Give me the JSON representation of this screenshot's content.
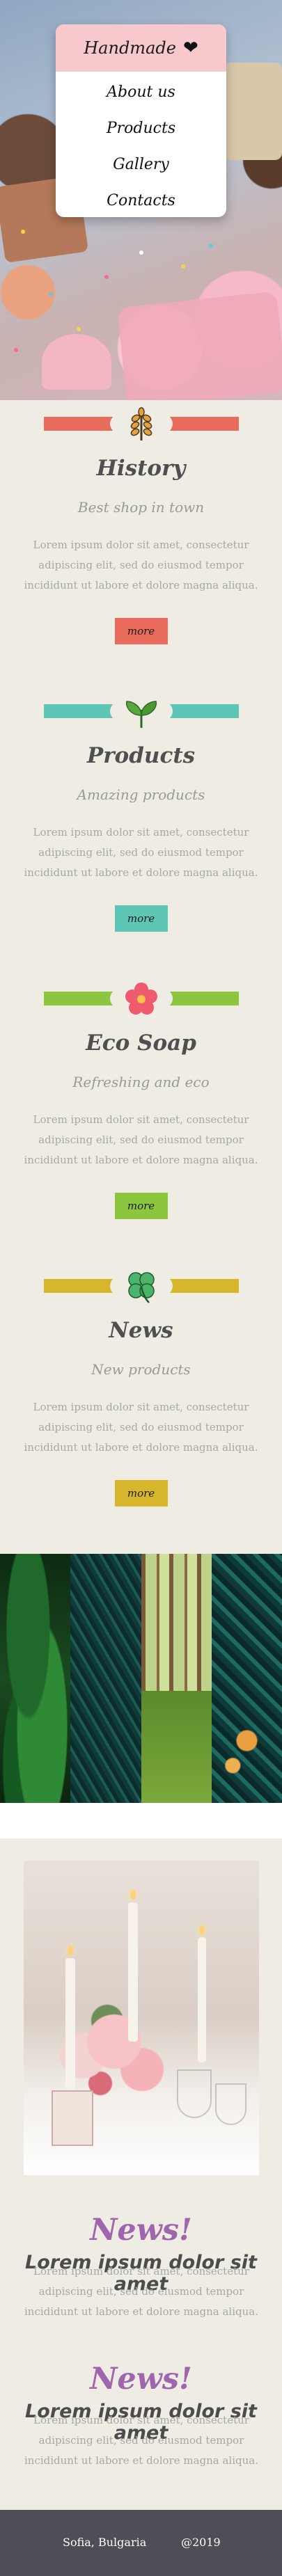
{
  "menu": {
    "brand": "Handmade",
    "brand_icon": "heart-icon",
    "items": [
      "About us",
      "Products",
      "Gallery",
      "Contacts"
    ]
  },
  "sections": [
    {
      "title": "History",
      "subtitle": "Best shop in town",
      "body": "Lorem ipsum dolor sit amet, consectetur adipiscing elit, sed do eiusmod tempor incididunt ut labore et dolore magna aliqua.",
      "button": "more",
      "color": "#e86b5c",
      "icon": "wheat-icon"
    },
    {
      "title": "Products",
      "subtitle": "Amazing products",
      "body": "Lorem ipsum dolor sit amet, consectetur adipiscing elit, sed do eiusmod tempor incididunt ut labore et dolore magna aliqua.",
      "button": "more",
      "color": "#5ec6b4",
      "icon": "leaves-icon"
    },
    {
      "title": "Eco Soap",
      "subtitle": "Refreshing and eco",
      "body": "Lorem ipsum dolor sit amet, consectetur adipiscing elit, sed do eiusmod tempor incididunt ut labore et dolore magna aliqua.",
      "button": "more",
      "color": "#8cc63f",
      "icon": "flower-icon"
    },
    {
      "title": "News",
      "subtitle": "New products",
      "body": "Lorem ipsum dolor sit amet, consectetur adipiscing elit, sed do eiusmod tempor incididunt ut labore et dolore magna aliqua.",
      "button": "more",
      "color": "#d8b62c",
      "icon": "clover-icon"
    }
  ],
  "news": [
    {
      "title": "News!",
      "headline": "Lorem ipsum dolor sit amet",
      "body": "Lorem ipsum dolor sit amet, consectetur adipiscing elit, sed do eiusmod tempor incididunt ut labore et dolore magna aliqua."
    },
    {
      "title": "News!",
      "headline": "Lorem ipsum dolor sit amet",
      "body": "Lorem ipsum dolor sit amet, consectetur adipiscing elit, sed do eiusmod tempor incididunt ut labore et dolore magna aliqua."
    }
  ],
  "footer": {
    "location": "Sofia, Bulgaria",
    "year": "@2019"
  },
  "colors": {
    "content_bg": "#efede3",
    "footer_bg": "#4f4d55",
    "news_title": "#a066ad",
    "menu_header": "#f7c9cc"
  }
}
